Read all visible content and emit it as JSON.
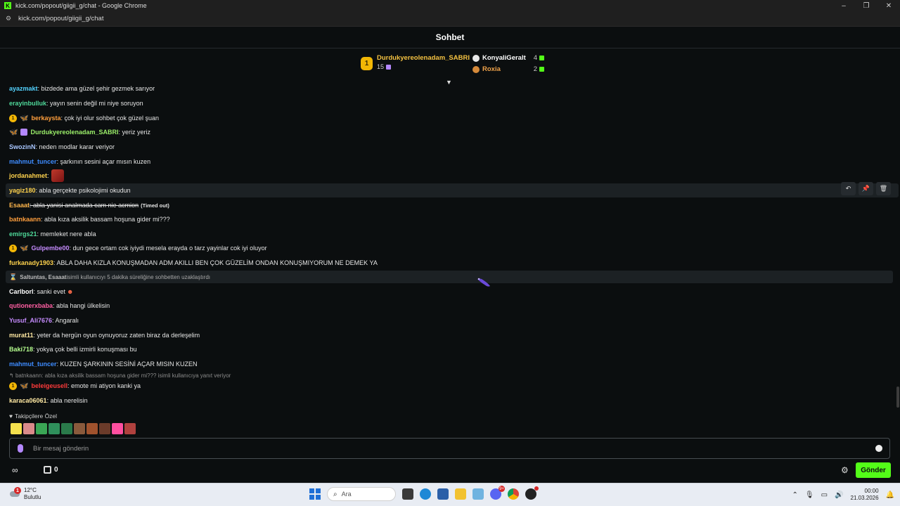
{
  "browser": {
    "window_title": "kick.com/popout/giigii_g/chat - Google Chrome",
    "url": "kick.com/popout/giigii_g/chat",
    "favicon_letter": "K"
  },
  "chat": {
    "title": "Sohbet"
  },
  "leaderboard": {
    "first": {
      "rank": "1",
      "name": "Durdukyereolenadam_SABRI",
      "count": "15"
    },
    "second": {
      "name": "KonyaliGeralt",
      "count": "4"
    },
    "third": {
      "name": "Roxia",
      "count": "2"
    }
  },
  "messages": [
    {
      "user": "ayazmakt",
      "color": "#53d3ff",
      "text": ": bizdede ama güzel şehir gezmek sarıyor"
    },
    {
      "user": "erayinbulluk",
      "color": "#4fd99a",
      "text": ": yayın senin değil mi niye soruyon"
    },
    {
      "user": "berkaysta",
      "color": "#ff9f3d",
      "text": ": çok iyi olur sohbet çok güzel şuan"
    },
    {
      "user": "Durdukyereolenadam_SABRI",
      "color": "#9cf06a",
      "text": ": yeriz yeriz"
    },
    {
      "user": "SwozinN",
      "color": "#a9c7ff",
      "text": ": neden modlar karar veriyor"
    },
    {
      "user": "mahmut_tuncer",
      "color": "#3e8cff",
      "text": ": şarkının sesini açar mısın kuzen"
    },
    {
      "user": "jordanahmet",
      "color": "#ffd34d",
      "text": ":"
    },
    {
      "user": "yagiz180",
      "color": "#ffd34d",
      "text": ": abla gerçekte psikolojimi okudun"
    },
    {
      "user": "Esaaat",
      "color": "#ffb74d",
      "text": ": abla yanisi analmada cam nie acmion",
      "timed": "(Timed out)"
    },
    {
      "user": "batnkaann",
      "color": "#ff9f3d",
      "text": ": abla kıza aksilik bassam hoşuna gider mi???"
    },
    {
      "user": "emirgs21",
      "color": "#4fd99a",
      "text": ": memleket nere abla"
    },
    {
      "user": "Gulpembe00",
      "color": "#c68cff",
      "text": ": dun gece ortam cok iyiydi mesela erayda o tarz yayinlar cok iyi oluyor"
    },
    {
      "user": "furkanady1903",
      "color": "#ffd34d",
      "text": ": ABLA DAHA KIZLA KONUŞMADAN ADM AKILLI BEN ÇOK GÜZELİM ONDAN KONUŞMIYORUM NE DEMEK YA"
    },
    {
      "user": "Carlborl",
      "color": "#ffffff",
      "text": ": sanki evet"
    },
    {
      "user": "qutionerxbaba",
      "color": "#ff5fa2",
      "text": ": abla hangi ülkelisin"
    },
    {
      "user": "Yusuf_Ali7676",
      "color": "#c68cff",
      "text": ": Angaralı"
    },
    {
      "user": "murat11",
      "color": "#ffe9a3",
      "text": ": yeter da hergün oyun oynuyoruz zaten biraz da derleşelim"
    },
    {
      "user": "Baki718",
      "color": "#b6ff8f",
      "text": ": yokya çok belli izmirli konuşması bu"
    },
    {
      "user": "mahmut_tuncer",
      "color": "#3e8cff",
      "text": ": KUZEN ŞARKININ SESİNİ AÇAR MISIN KUZEN"
    },
    {
      "user": "beleigeusell",
      "color": "#ff3b3b",
      "text": ": emote mi atiyon kanki ya"
    },
    {
      "user": "karaca06061",
      "color": "#ffe9a3",
      "text": ": abla nerelisin"
    }
  ],
  "system_notice": {
    "users": "Saltuntas, Esaaat",
    "text": " isimli kullanıcıyı 5 dakika süreliğine sohbetten uzaklaştırdı"
  },
  "reply_reference": "batnkaann: abla kıza aksilik bassam hoşuna gider mi??? isimli kullanıcıya yanıt veriyor",
  "emote_panel": {
    "label": "Takipçilere Özel",
    "emotes": [
      "#f4e04d",
      "#d98a8a",
      "#3aa655",
      "#2f8f5b",
      "#2a7a4a",
      "#8a5a3c",
      "#a0522d",
      "#6b3b2a",
      "#ff4fa0",
      "#b0413e"
    ]
  },
  "input": {
    "placeholder": "Bir mesaj gönderin"
  },
  "footer": {
    "infinity": "∞",
    "points": "0",
    "send_label": "Gönder"
  },
  "taskbar": {
    "weather_alert": "1",
    "temperature": "12°C",
    "weather_desc": "Bulutlu",
    "search_placeholder": "Ara",
    "discord_badge": "9+",
    "time": "00:00",
    "date": "21.03.2026"
  },
  "colors": {
    "accent": "#53fc18",
    "background": "#0b0e0f",
    "gold": "#f2b705"
  }
}
